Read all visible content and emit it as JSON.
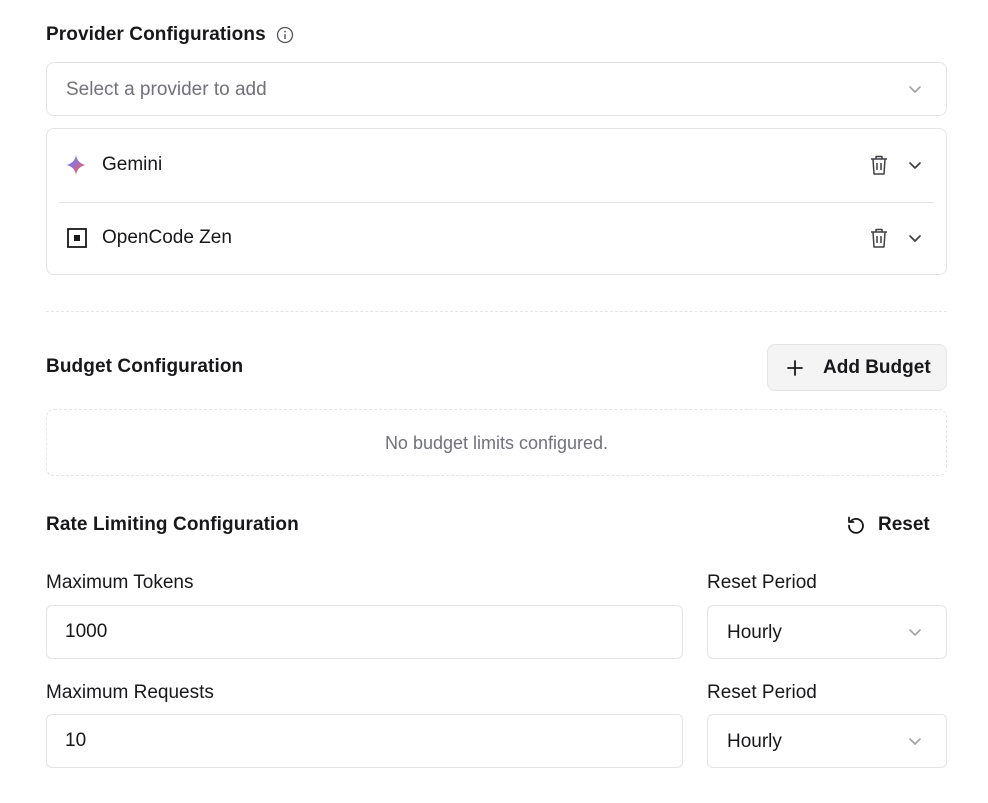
{
  "providers": {
    "title": "Provider Configurations",
    "info_icon": "info-icon",
    "select_placeholder": "Select a provider to add",
    "items": [
      {
        "label": "Gemini",
        "icon": "gemini-sparkle-icon"
      },
      {
        "label": "OpenCode Zen",
        "icon": "opencode-zen-icon"
      }
    ]
  },
  "budget": {
    "title": "Budget Configuration",
    "add_label": "Add Budget",
    "empty_message": "No budget limits configured."
  },
  "rate_limiting": {
    "title": "Rate Limiting Configuration",
    "reset_label": "Reset",
    "max_tokens_label": "Maximum Tokens",
    "max_tokens_value": "1000",
    "tokens_period_label": "Reset Period",
    "tokens_period_value": "Hourly",
    "max_requests_label": "Maximum Requests",
    "max_requests_value": "10",
    "requests_period_label": "Reset Period",
    "requests_period_value": "Hourly"
  },
  "colors": {
    "border": "#e4e4e7",
    "muted_text": "#71717a",
    "text": "#18181b",
    "button_bg": "#f4f4f5"
  }
}
